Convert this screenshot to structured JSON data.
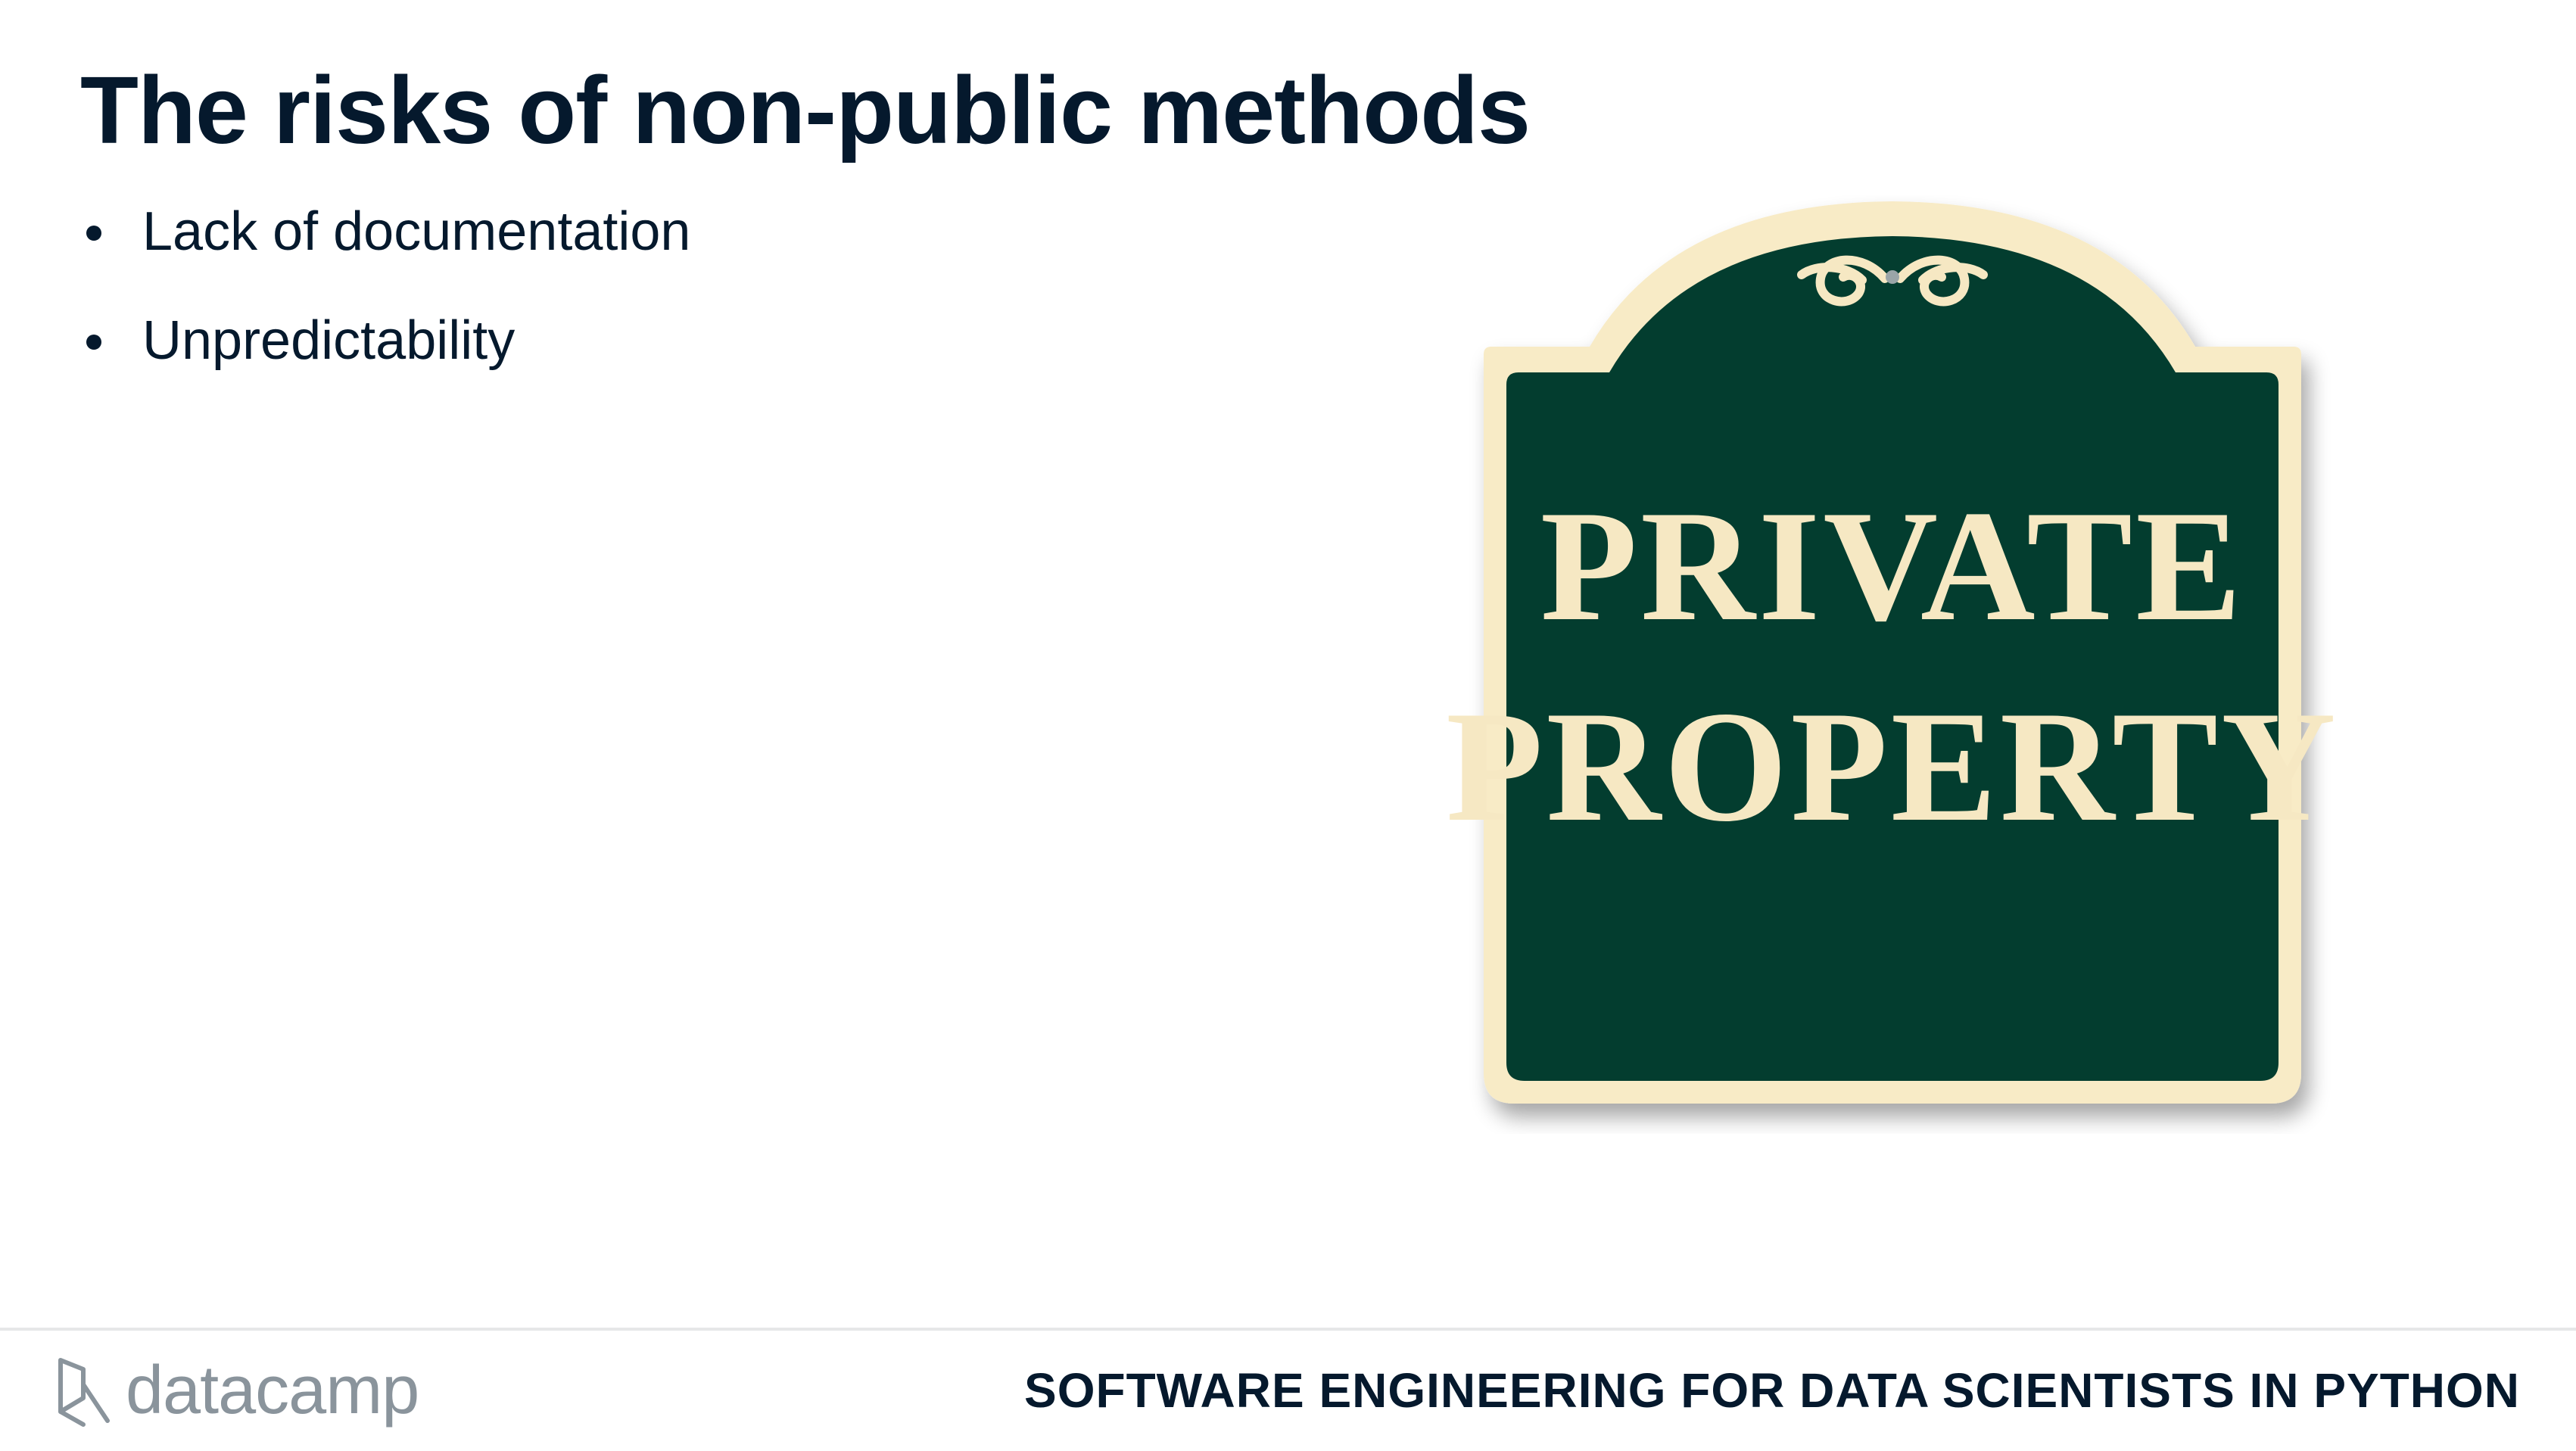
{
  "slide": {
    "title": "The risks of non-public methods",
    "bullets": [
      "Lack of documentation",
      "Unpredictability"
    ]
  },
  "image": {
    "sign_line_1": "PRIVATE",
    "sign_line_2": "PROPERTY",
    "sign_color": "#033d2f",
    "sign_border_color": "#f8ebc6",
    "sign_text_color": "#f6e8c3"
  },
  "footer": {
    "logo_text": "datacamp",
    "course_title": "SOFTWARE ENGINEERING FOR DATA SCIENTISTS IN PYTHON",
    "logo_icon": "datacamp-logo-icon"
  },
  "colors": {
    "text": "#05192d",
    "logo_gray": "#8a949c",
    "rule": "#e6e7e8"
  }
}
